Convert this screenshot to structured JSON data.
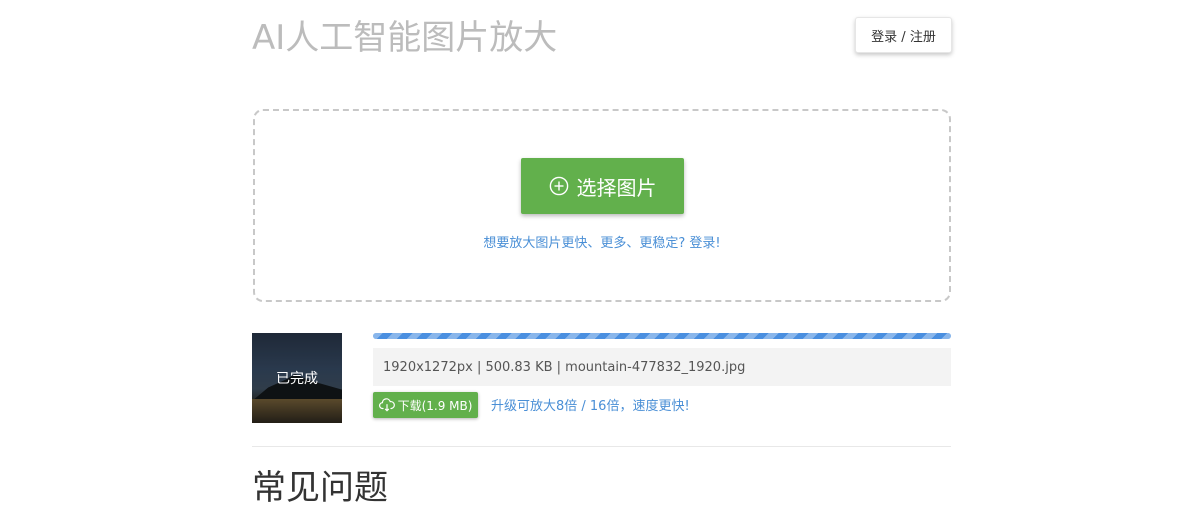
{
  "header": {
    "title": "AI人工智能图片放大",
    "login_label": "登录 / 注册"
  },
  "upload": {
    "select_label": "选择图片",
    "login_hint": "想要放大图片更快、更多、更稳定? 登录!"
  },
  "task": {
    "status": "已完成",
    "progress_percent": 100,
    "file_info": "1920x1272px | 500.83 KB | mountain-477832_1920.jpg",
    "download_label": "下载(1.9 MB)",
    "upgrade_hint": "升级可放大8倍 / 16倍，速度更快!"
  },
  "faq": {
    "title": "常见问题"
  },
  "colors": {
    "primary_green": "#62b04c",
    "link_blue": "#4a8fd6",
    "progress_blue": "#4a8fe0",
    "title_gray": "#bcbcbc"
  },
  "icons": {
    "select": "plus-circle-icon",
    "download": "cloud-download-icon"
  }
}
